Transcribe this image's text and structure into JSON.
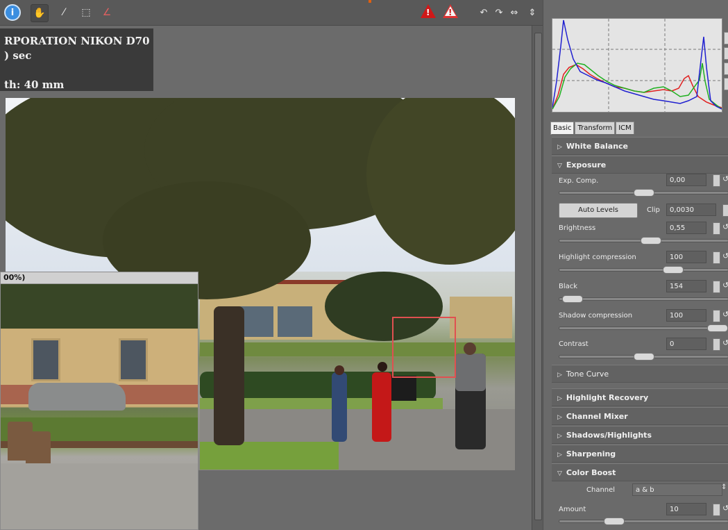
{
  "toolbar": {
    "info_icon": "info-icon",
    "warn_label": "!",
    "rotate_left": "↶",
    "rotate_right": "↷",
    "flip_h": "⇔",
    "flip_v": "⇕",
    "hand": "✋",
    "picker": "⁄",
    "crop": "⬚",
    "straighten": "∠"
  },
  "exif": {
    "lines": [
      "RPORATION NIKON D70",
      ") sec",
      "",
      "th: 40 mm"
    ]
  },
  "detail": {
    "title": "00%)"
  },
  "tabs": [
    "Basic",
    "Transform",
    "ICM"
  ],
  "sections": {
    "white_balance": "White Balance",
    "exposure": "Exposure",
    "tone_curve": "Tone Curve",
    "highlight_recovery": "Highlight Recovery",
    "channel_mixer": "Channel Mixer",
    "shadows_highlights": "Shadows/Highlights",
    "sharpening": "Sharpening",
    "color_boost": "Color Boost"
  },
  "exposure": {
    "exp_comp": {
      "label": "Exp. Comp.",
      "value": "0,00",
      "level": 0.5
    },
    "auto_levels": "Auto Levels",
    "clip_label": "Clip",
    "clip_value": "0,0030",
    "brightness": {
      "label": "Brightness",
      "value": "0,55",
      "level": 0.55
    },
    "highlight_compression": {
      "label": "Highlight compression",
      "value": "100",
      "level": 0.7
    },
    "black": {
      "label": "Black",
      "value": "154",
      "level": 0.02
    },
    "shadow_compression": {
      "label": "Shadow compression",
      "value": "100",
      "level": 1.0
    },
    "contrast": {
      "label": "Contrast",
      "value": "0",
      "level": 0.5
    }
  },
  "color_boost": {
    "channel_label": "Channel",
    "channel_value": "a & b",
    "amount": {
      "label": "Amount",
      "value": "10",
      "level": 0.3
    }
  },
  "icons": {
    "spin": "spin-icon",
    "reset": "reset-icon",
    "expanded": "▽",
    "collapsed": "▷",
    "reset_glyph": "↺"
  },
  "colors": {
    "panel": "#6a6a6a",
    "hist_red": "#e02020",
    "hist_green": "#20b020",
    "hist_blue": "#2020d0",
    "zoom_rect": "#e05050"
  }
}
